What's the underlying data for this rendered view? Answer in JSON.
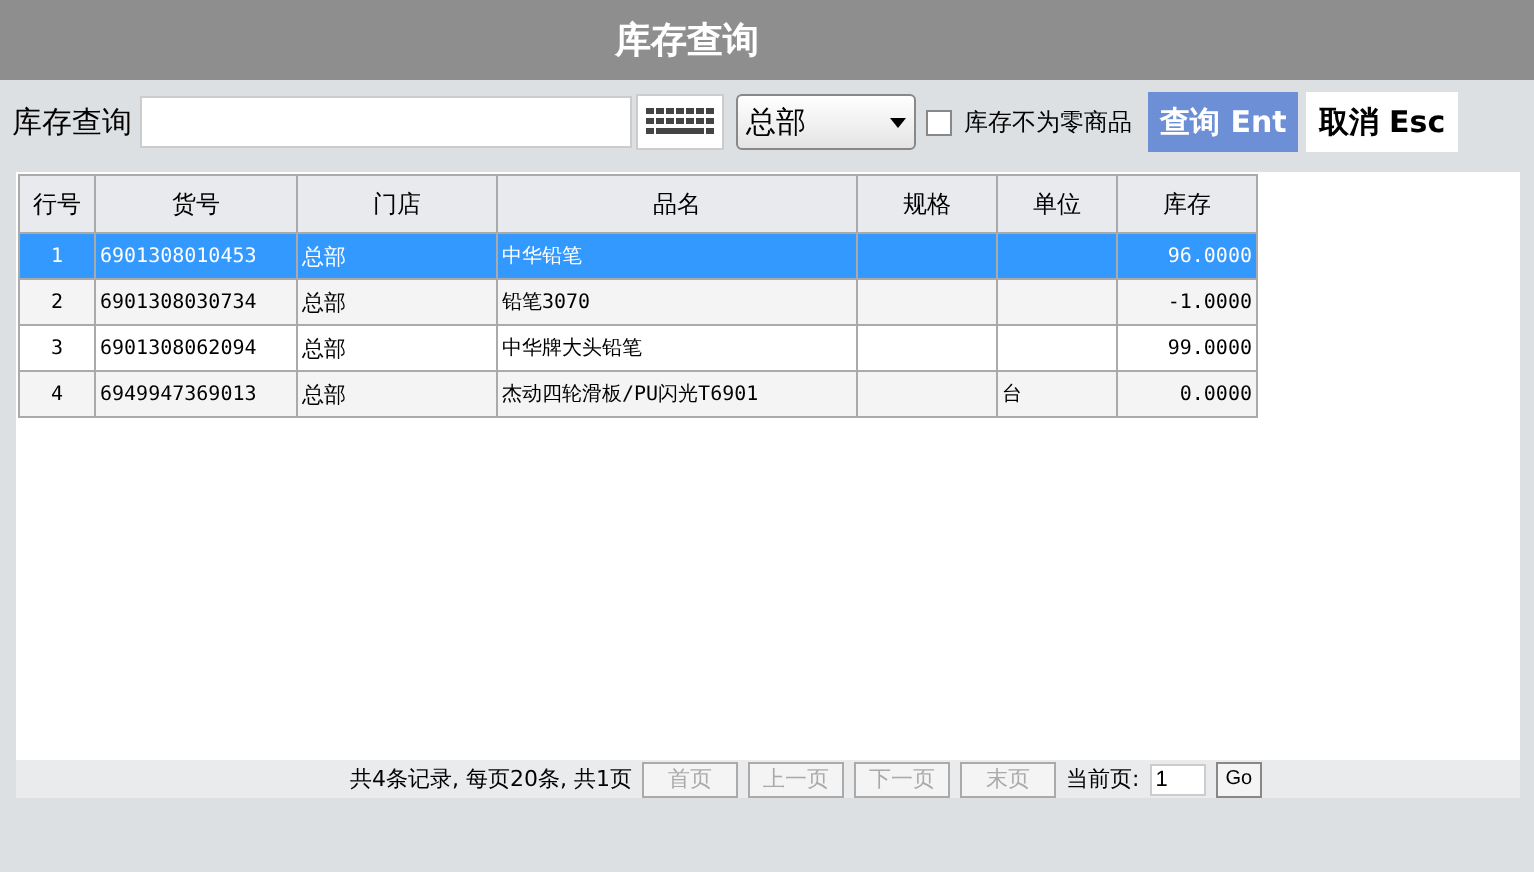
{
  "header": {
    "title": "库存查询"
  },
  "toolbar": {
    "label": "库存查询",
    "store": "总部",
    "nonzero": {
      "label": "库存不为零商品",
      "checked": false
    },
    "buttons": [
      {
        "label": "查询 Ent",
        "kind": "primary"
      },
      {
        "label": "取消 Esc",
        "kind": "plain"
      }
    ]
  },
  "table": {
    "columns": [
      "行号",
      "货号",
      "门店",
      "品名",
      "规格",
      "单位",
      "库存"
    ],
    "rows": [
      {
        "cells": [
          "1",
          "6901308010453",
          "总部",
          "中华铅笔",
          "",
          "",
          "96.0000"
        ],
        "selected": true
      },
      {
        "cells": [
          "2",
          "6901308030734",
          "总部",
          "铅笔3070",
          "",
          "",
          "-1.0000"
        ],
        "selected": false
      },
      {
        "cells": [
          "3",
          "6901308062094",
          "总部",
          "中华牌大头铅笔",
          "",
          "",
          "99.0000"
        ],
        "selected": false
      },
      {
        "cells": [
          "4",
          "6949947369013",
          "总部",
          "杰动四轮滑板/PU闪光T6901",
          "",
          "台",
          "0.0000"
        ],
        "selected": false
      }
    ]
  },
  "pager": {
    "summary": "共4条记录, 每页20条, 共1页",
    "buttons": [
      {
        "label": "首页",
        "disabled": true
      },
      {
        "label": "上一页",
        "disabled": true
      },
      {
        "label": "下一页",
        "disabled": true
      },
      {
        "label": "末页",
        "disabled": true
      }
    ],
    "page_label": "当前页:",
    "page": "1",
    "go": "Go"
  }
}
